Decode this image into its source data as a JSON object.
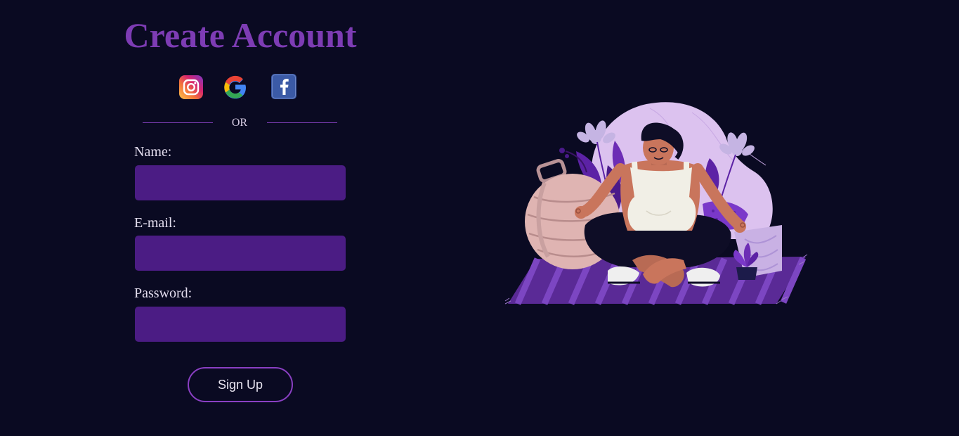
{
  "form": {
    "title": "Create Account",
    "divider_text": "OR",
    "fields": [
      {
        "label": "Name:",
        "value": "",
        "type": "text"
      },
      {
        "label": "E-mail:",
        "value": "",
        "type": "email"
      },
      {
        "label": "Password:",
        "value": "",
        "type": "password"
      }
    ],
    "submit_label": "Sign Up"
  },
  "social": [
    {
      "icon": "instagram-icon"
    },
    {
      "icon": "google-icon"
    },
    {
      "icon": "facebook-icon"
    }
  ],
  "illustration": {
    "icon": "meditation-illustration"
  },
  "colors": {
    "background": "#0a0a22",
    "accent": "#7d3cb4",
    "input_background": "#4b1c84",
    "button_border": "#8a3fc3",
    "text": "#e2dced"
  }
}
